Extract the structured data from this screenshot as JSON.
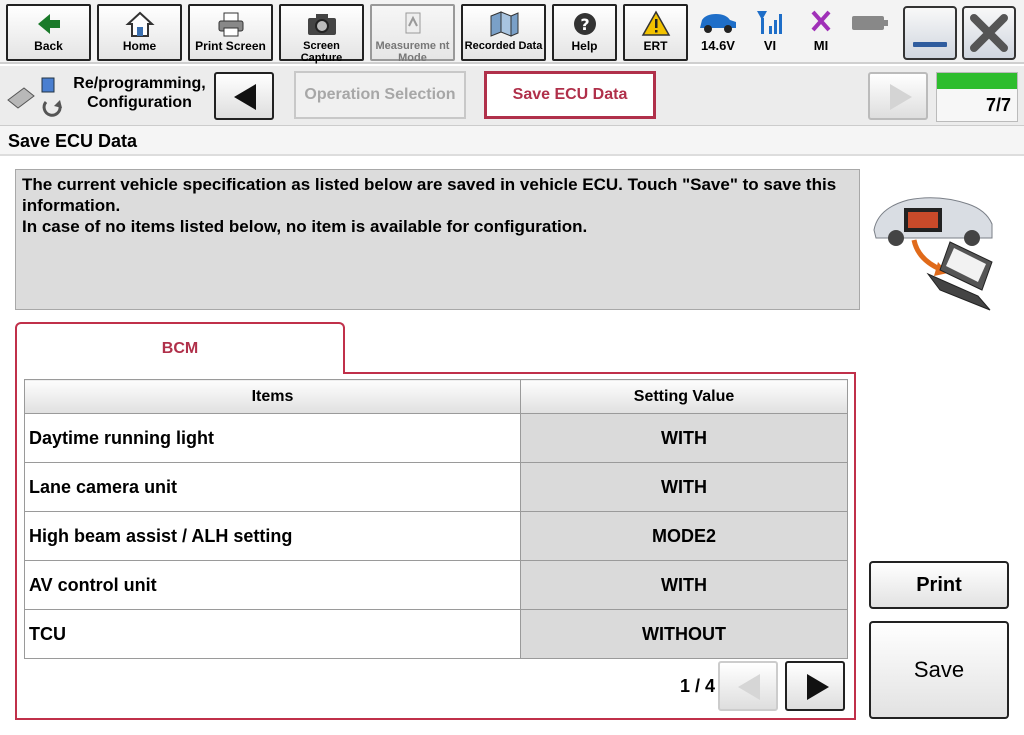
{
  "toolbar": {
    "back": "Back",
    "home": "Home",
    "print_screen": "Print Screen",
    "screen_capture": "Screen Capture",
    "measurement_mode": "Measureme nt Mode",
    "recorded_data": "Recorded Data",
    "help": "Help",
    "ert": "ERT",
    "voltage": "14.6V",
    "vi": "VI",
    "mi": "MI"
  },
  "breadcrumb": {
    "app": "Re/programming, Configuration",
    "step_operation": "Operation Selection",
    "step_save": "Save ECU Data",
    "progress": "7/7",
    "progress_fraction": 1.0
  },
  "page_title": "Save ECU Data",
  "info": {
    "line1": "The current vehicle specification as listed below are saved in vehicle ECU. Touch \"Save\" to save this information.",
    "line2": "In case of no items listed below, no item is available for configuration."
  },
  "tab": {
    "label": "BCM"
  },
  "table": {
    "headers": [
      "Items",
      "Setting Value"
    ],
    "rows": [
      {
        "item": "Daytime running light",
        "value": "WITH"
      },
      {
        "item": "Lane camera unit",
        "value": "WITH"
      },
      {
        "item": "High beam assist / ALH setting",
        "value": "MODE2"
      },
      {
        "item": "AV control unit",
        "value": "WITH"
      },
      {
        "item": "TCU",
        "value": "WITHOUT"
      }
    ]
  },
  "pager": {
    "text": "1 / 4"
  },
  "buttons": {
    "print": "Print",
    "save": "Save"
  },
  "colors": {
    "accent": "#b0304a",
    "progress": "#2ebd2e"
  }
}
